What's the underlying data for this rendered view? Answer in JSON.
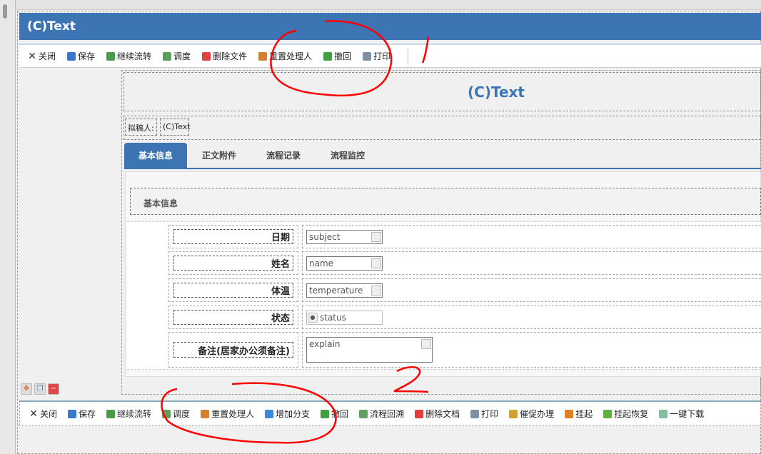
{
  "window": {
    "title": "(C)Text"
  },
  "toolbar": [
    {
      "label": "关闭",
      "icon": "close-icon",
      "color": "#333"
    },
    {
      "label": "保存",
      "icon": "save-icon",
      "color": "#3a78c8"
    },
    {
      "label": "继续流转",
      "icon": "forward-icon",
      "color": "#4a9a4a"
    },
    {
      "label": "调度",
      "icon": "dispatch-icon",
      "color": "#5aa05a"
    },
    {
      "label": "删除文件",
      "icon": "delete-icon",
      "color": "#e04040"
    },
    {
      "label": "重置处理人",
      "icon": "user-reset-icon",
      "color": "#d08030"
    },
    {
      "label": "撤回",
      "icon": "undo-icon",
      "color": "#40a040"
    },
    {
      "label": "打印",
      "icon": "print-icon",
      "color": "#8090a0"
    }
  ],
  "form": {
    "heading": "(C)Text",
    "drafter_label": "拟稿人:",
    "drafter_value": "(C)Text",
    "tabs": [
      "基本信息",
      "正文附件",
      "流程记录",
      "流程监控"
    ],
    "section_title": "基本信息",
    "fields": [
      {
        "label": "日期",
        "value": "subject",
        "icon": "calendar-icon"
      },
      {
        "label": "姓名",
        "value": "name",
        "icon": "edit-icon"
      },
      {
        "label": "体温",
        "value": "temperature",
        "icon": "edit-icon"
      },
      {
        "label": "状态",
        "value": "status",
        "icon": "radio-icon"
      },
      {
        "label": "备注(居家办公须备注)",
        "value": "explain",
        "icon": "textarea-icon"
      }
    ]
  },
  "bottom_toolbar": [
    {
      "label": "关闭",
      "color": "#333"
    },
    {
      "label": "保存",
      "color": "#3a78c8"
    },
    {
      "label": "继续流转",
      "color": "#4a9a4a"
    },
    {
      "label": "调度",
      "color": "#5aa05a"
    },
    {
      "label": "重置处理人",
      "color": "#d08030"
    },
    {
      "label": "增加分支",
      "color": "#3a88d8"
    },
    {
      "label": "撤回",
      "color": "#40a040"
    },
    {
      "label": "流程回溯",
      "color": "#60a060"
    },
    {
      "label": "删除文档",
      "color": "#e04040"
    },
    {
      "label": "打印",
      "color": "#8090a0"
    },
    {
      "label": "催促办理",
      "color": "#d0a030"
    },
    {
      "label": "挂起",
      "color": "#e08020"
    },
    {
      "label": "挂起恢复",
      "color": "#60b040"
    },
    {
      "label": "一键下载",
      "color": "#80c0a0"
    }
  ]
}
